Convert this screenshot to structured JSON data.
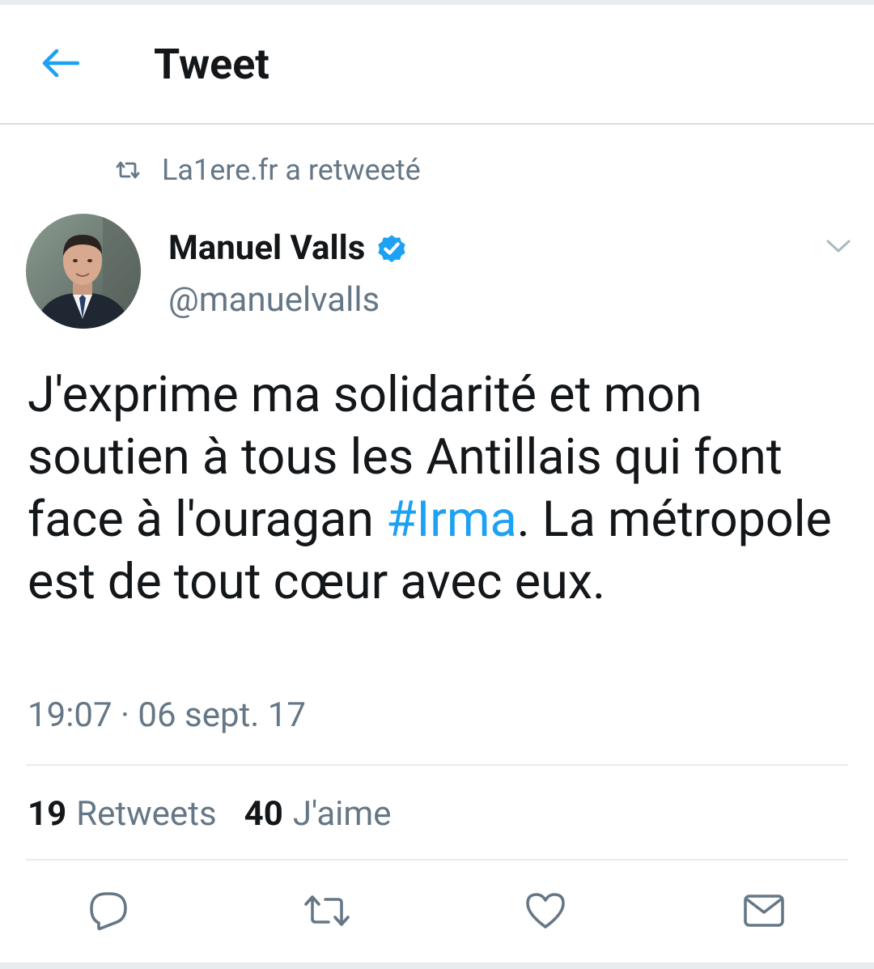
{
  "colors": {
    "accent": "#1da1f2",
    "text_primary": "#14171a",
    "text_secondary": "#657786",
    "divider": "#e6ecf0",
    "background": "#ffffff"
  },
  "header": {
    "back_icon": "arrow-left-icon",
    "title": "Tweet"
  },
  "social_context": {
    "icon": "retweet-icon",
    "text": "La1ere.fr a retweeté"
  },
  "tweet": {
    "author": {
      "name": "Manuel Valls",
      "verified": true,
      "handle": "@manuelvalls",
      "avatar_icon": "profile-photo"
    },
    "menu_icon": "chevron-down-icon",
    "text_before": "J'exprime ma solidarité et mon soutien à tous les Antillais qui font face à l'ouragan ",
    "hashtag": "#Irma",
    "text_after": ". La métropole est de tout cœur avec eux.",
    "timestamp": "19:07 · 06 sept. 17",
    "stats": {
      "retweets_count": "19",
      "retweets_label": "Retweets",
      "likes_count": "40",
      "likes_label": "J'aime"
    }
  },
  "actions": [
    {
      "name": "reply-button",
      "icon": "reply-icon"
    },
    {
      "name": "retweet-button",
      "icon": "retweet-icon"
    },
    {
      "name": "like-button",
      "icon": "heart-icon"
    },
    {
      "name": "share-button",
      "icon": "envelope-icon"
    }
  ]
}
